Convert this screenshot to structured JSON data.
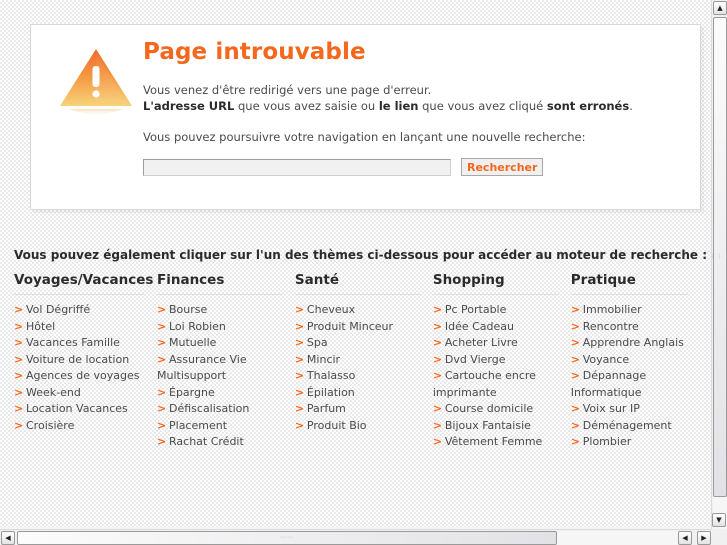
{
  "card": {
    "icon": "warning-triangle-icon",
    "title": "Page introuvable",
    "line1": "Vous venez d'être redirigé vers une page d'erreur.",
    "line2_a": "L'adresse URL",
    "line2_b": " que vous avez saisie ou ",
    "line2_c": "le lien",
    "line2_d": " que vous avez cliqué ",
    "line2_e": "sont erronés",
    "line2_f": ".",
    "line3": "Vous pouvez poursuivre votre navigation en lançant une nouvelle recherche:",
    "search_value": "",
    "search_placeholder": "",
    "search_button": "Rechercher"
  },
  "themes": {
    "intro": "Vous pouvez également cliquer sur l'un des thèmes ci-dessous pour accéder au moteur de recherche :",
    "columns": [
      {
        "heading": "Voyages/Vacances",
        "items": [
          {
            "label": "Vol Dégriffé",
            "chevron": true
          },
          {
            "label": "Hôtel",
            "chevron": true
          },
          {
            "label": "Vacances Famille",
            "chevron": true
          },
          {
            "label": "Voiture de location",
            "chevron": true
          },
          {
            "label": "Agences de voyages",
            "chevron": true
          },
          {
            "label": "Week-end",
            "chevron": true
          },
          {
            "label": "Location Vacances",
            "chevron": true
          },
          {
            "label": "Croisière",
            "chevron": true
          }
        ]
      },
      {
        "heading": "Finances",
        "items": [
          {
            "label": "Bourse",
            "chevron": true
          },
          {
            "label": "Loi Robien",
            "chevron": true
          },
          {
            "label": "Mutuelle",
            "chevron": true
          },
          {
            "label": "Assurance Vie",
            "chevron": true
          },
          {
            "label": "Multisupport",
            "chevron": false
          },
          {
            "label": "Épargne",
            "chevron": true
          },
          {
            "label": "Défiscalisation",
            "chevron": true
          },
          {
            "label": "Placement",
            "chevron": true
          },
          {
            "label": "Rachat Crédit",
            "chevron": true
          }
        ]
      },
      {
        "heading": "Santé",
        "items": [
          {
            "label": "Cheveux",
            "chevron": true
          },
          {
            "label": "Produit Minceur",
            "chevron": true
          },
          {
            "label": "Spa",
            "chevron": true
          },
          {
            "label": "Mincir",
            "chevron": true
          },
          {
            "label": "Thalasso",
            "chevron": true
          },
          {
            "label": "Épilation",
            "chevron": true
          },
          {
            "label": "Parfum",
            "chevron": true
          },
          {
            "label": "Produit Bio",
            "chevron": true
          }
        ]
      },
      {
        "heading": "Shopping",
        "items": [
          {
            "label": "Pc Portable",
            "chevron": true
          },
          {
            "label": "Idée Cadeau",
            "chevron": true
          },
          {
            "label": "Acheter Livre",
            "chevron": true
          },
          {
            "label": "Dvd Vierge",
            "chevron": true
          },
          {
            "label": "Cartouche encre",
            "chevron": true
          },
          {
            "label": "imprimante",
            "chevron": false
          },
          {
            "label": "Course domicile",
            "chevron": true
          },
          {
            "label": "Bijoux Fantaisie",
            "chevron": true
          },
          {
            "label": "Vêtement Femme",
            "chevron": true
          }
        ]
      },
      {
        "heading": "Pratique",
        "items": [
          {
            "label": "Immobilier",
            "chevron": true
          },
          {
            "label": "Rencontre",
            "chevron": true
          },
          {
            "label": "Apprendre Anglais",
            "chevron": true
          },
          {
            "label": "Voyance",
            "chevron": true
          },
          {
            "label": "Dépannage",
            "chevron": true
          },
          {
            "label": "Informatique",
            "chevron": false
          },
          {
            "label": "Voix sur IP",
            "chevron": true
          },
          {
            "label": "Déménagement",
            "chevron": true
          },
          {
            "label": "Plombier",
            "chevron": true
          }
        ]
      }
    ]
  },
  "scrollbars": {
    "up_arrow": "▲",
    "down_arrow": "▼",
    "left_arrow": "◀",
    "right_arrow": "▶",
    "grip": "⣿"
  },
  "colors": {
    "accent": "#f4671c",
    "text": "#4a4a4a",
    "heading": "#2b2b2b",
    "card_bg": "#ffffff"
  }
}
